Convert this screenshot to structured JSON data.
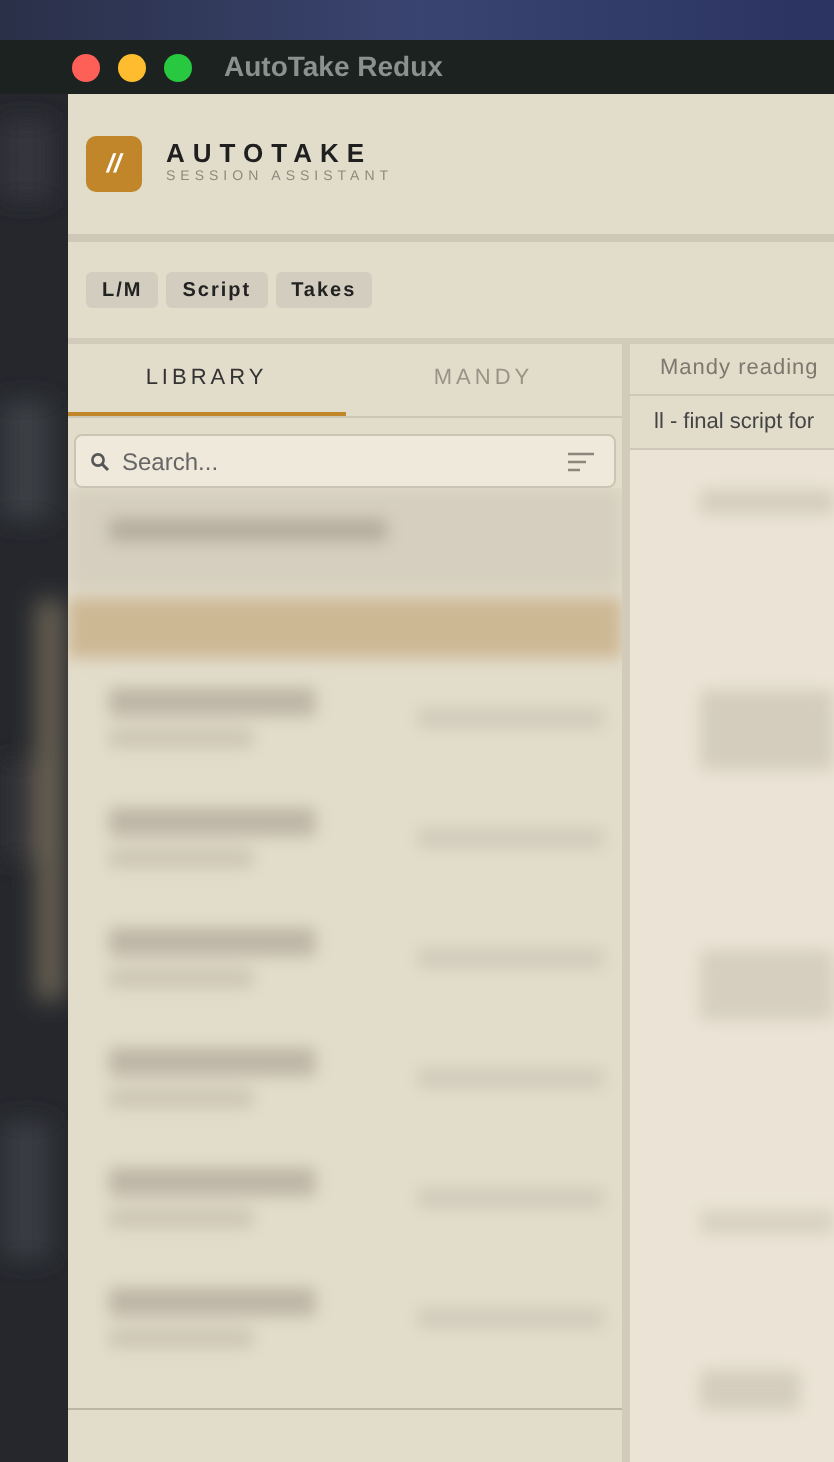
{
  "window": {
    "title": "AutoTake Redux"
  },
  "brand": {
    "mark": "//",
    "name": "AUTOTAKE",
    "subtitle": "SESSION ASSISTANT"
  },
  "toolbar": {
    "buttons": [
      "L/M",
      "Script",
      "Takes"
    ]
  },
  "tabs": [
    {
      "label": "LIBRARY",
      "selected": true
    },
    {
      "label": "MANDY",
      "selected": false
    }
  ],
  "search": {
    "placeholder": "Search..."
  },
  "right_panel": {
    "title": "Mandy reading",
    "subtitle": "ll - final script for"
  }
}
